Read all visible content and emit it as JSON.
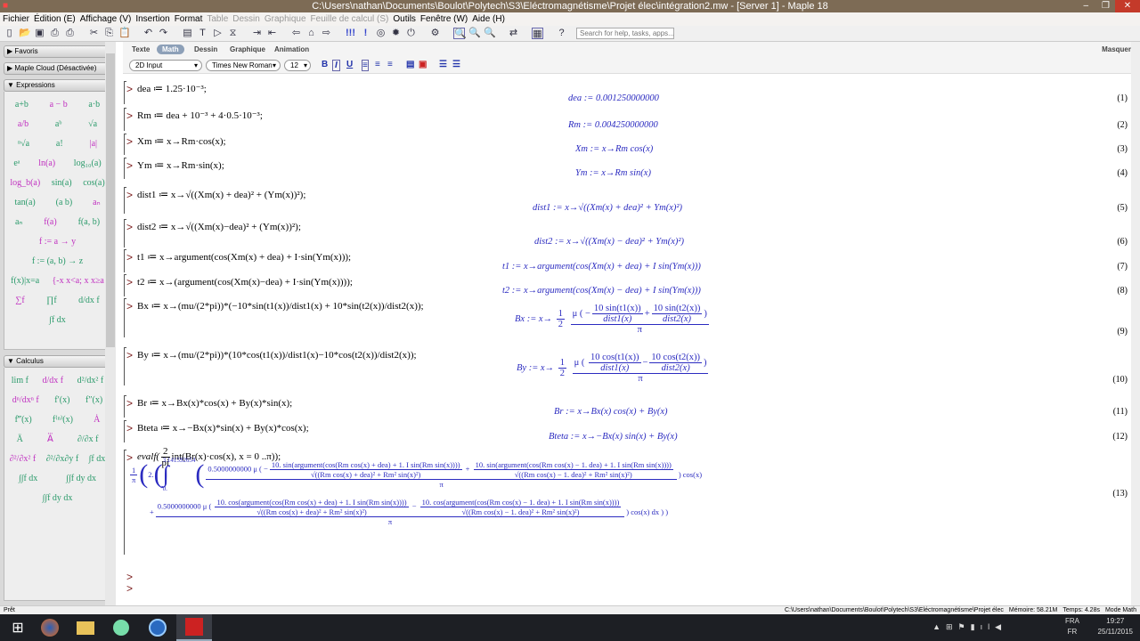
{
  "window": {
    "title": "C:\\Users\\nathan\\Documents\\Boulot\\Polytech\\S3\\Eléctromagnétisme\\Projet élec\\intégration2.mw - [Server 1] - Maple 18",
    "minimize": "–",
    "maximize": "❐",
    "close": "✕"
  },
  "menu": [
    {
      "label": "Fichier"
    },
    {
      "label": "Édition (E)"
    },
    {
      "label": "Affichage (V)"
    },
    {
      "label": "Insertion"
    },
    {
      "label": "Format"
    },
    {
      "label": "Table",
      "disabled": true
    },
    {
      "label": "Dessin",
      "disabled": true
    },
    {
      "label": "Graphique",
      "disabled": true
    },
    {
      "label": "Feuille de calcul (S)",
      "disabled": true
    },
    {
      "label": "Outils"
    },
    {
      "label": "Fenêtre (W)"
    },
    {
      "label": "Aide (H)"
    }
  ],
  "toolbar": {
    "search_placeholder": "Search for help, tasks, apps..."
  },
  "palettes": {
    "favoris": "Favoris",
    "cloud": "Maple Cloud (Désactivée)",
    "expressions": "Expressions",
    "calculus": "Calculus",
    "expr_rows": [
      [
        "a+b",
        "a − b",
        "a·b"
      ],
      [
        "a/b",
        "aᵇ",
        "√a"
      ],
      [
        "ⁿ√a",
        "a!",
        "|a|"
      ],
      [
        "eᵃ",
        "ln(a)",
        "log₁₀(a)"
      ],
      [
        "log_b(a)",
        "sin(a)",
        "cos(a)"
      ],
      [
        "tan(a)",
        "(a b)",
        "aₙ"
      ],
      [
        "aₙ",
        "f(a)",
        "f(a, b)"
      ],
      [
        "f := a → y"
      ],
      [
        "f := (a, b) → z"
      ],
      [
        "f(x)|x=a",
        "{-x x<a; x x≥a"
      ],
      [
        "∑f",
        "∏f",
        "d/dx f"
      ],
      [
        "∫f dx"
      ]
    ],
    "calc_rows": [
      [
        "lim f",
        "d/dx f",
        "d²/dx² f"
      ],
      [
        "dⁿ/dxⁿ f",
        "f′(x)",
        "f″(x)"
      ],
      [
        "f‴(x)",
        "f⁽ⁿ⁾(x)",
        "Ȧ"
      ],
      [
        "Ä",
        "A⃛",
        "∂/∂x f"
      ],
      [
        "∂²/∂x² f",
        "∂²/∂x∂y f",
        "∫f dx"
      ],
      [
        "∫∫f dx",
        "∫∫f dy dx"
      ],
      [
        "∫∫f dy dx"
      ]
    ]
  },
  "context": {
    "modes": [
      "Texte",
      "Math",
      "Dessin",
      "Graphique",
      "Animation"
    ],
    "input_mode": "2D Input",
    "font": "Times New Roman",
    "size": "12",
    "masquer": "Masquer"
  },
  "rows": [
    {
      "in": "dea ≔ 1.25·10⁻³;",
      "out": "dea := 0.001250000000",
      "label": "(1)"
    },
    {
      "in": "Rm ≔ dea + 10⁻³ + 4·0.5·10⁻³;",
      "out": "Rm := 0.004250000000",
      "label": "(2)"
    },
    {
      "in": "Xm ≔ x→Rm·cos(x);",
      "out": "Xm := x→Rm cos(x)",
      "label": "(3)"
    },
    {
      "in": "Ym ≔ x→Rm·sin(x);",
      "out": "Ym := x→Rm sin(x)",
      "label": "(4)"
    },
    {
      "in": "dist1 ≔ x→√((Xm(x) + dea)² + (Ym(x))²);",
      "out": "dist1 := x→√((Xm(x) + dea)² + Ym(x)²)",
      "label": "(5)"
    },
    {
      "in": "dist2 ≔ x→√((Xm(x)−dea)² + (Ym(x))²);",
      "out": "dist2 := x→√((Xm(x) − dea)² + Ym(x)²)",
      "label": "(6)"
    },
    {
      "in": "t1 ≔ x→argument(cos(Xm(x) + dea) + I·sin(Ym(x)));",
      "out": "t1 := x→argument(cos(Xm(x) + dea) + I sin(Ym(x)))",
      "label": "(7)"
    },
    {
      "in": "t2 ≔ x→(argument(cos(Xm(x)−dea) + I·sin(Ym(x))));",
      "out": "t2 := x→argument(cos(Xm(x) − dea) + I sin(Ym(x)))",
      "label": "(8)"
    },
    {
      "in": "Bx ≔ x→(mu/(2*pi))*(−10*sin(t1(x))/dist1(x) + 10*sin(t2(x))/dist2(x));",
      "label": "(9)"
    },
    {
      "in": "By ≔ x→(mu/(2*pi))*(10*cos(t1(x))/dist1(x)−10*cos(t2(x))/dist2(x));",
      "label": "(10)"
    },
    {
      "in": "Br ≔ x→Bx(x)*cos(x) + By(x)*sin(x);",
      "out": "Br := x→Bx(x) cos(x) + By(x)",
      "label": "(11)"
    },
    {
      "in": "Bteta ≔ x→−Bx(x)*sin(x) + By(x)*cos(x);",
      "out": "Bteta := x→−Bx(x) sin(x) + By(x)",
      "label": "(12)"
    },
    {
      "in_a": "evalf(",
      "in_num": "2",
      "in_den": "pi",
      "in_b": "int(Br(x)·cos(x), x = 0 ..π));",
      "label": "(13)"
    }
  ],
  "bx": {
    "lhs": "Bx := x→",
    "half_n": "1",
    "half_d": "2",
    "mu": "μ (",
    "t1n": "10 sin(t1(x))",
    "t1d": "dist1(x)",
    "t2n": "10 sin(t2(x))",
    "t2d": "dist2(x)",
    "pi": "π",
    "op1": "−",
    "op2": "+",
    "close": ")"
  },
  "by": {
    "lhs": "By := x→",
    "half_n": "1",
    "half_d": "2",
    "mu": "μ (",
    "t1n": "10 cos(t1(x))",
    "t1d": "dist1(x)",
    "t2n": "10 cos(t2(x))",
    "t2d": "dist2(x)",
    "pi": "π",
    "op2": "−",
    "close": ")"
  },
  "r13": {
    "inv_n": "1",
    "inv_d": "π",
    "two": "2.",
    "upper": "3.141592654",
    "lower": "0.",
    "coef": "0.5000000000 μ (",
    "sin1n": "10. sin(argument(cos(Rm cos(x) + dea) + 1. I sin(Rm sin(x))))",
    "sin1d": "√((Rm cos(x) + dea)² + Rm² sin(x)²)",
    "sin2n": "10. sin(argument(cos(Rm cos(x) − 1. dea) + 1. I sin(Rm sin(x))))",
    "sin2d": "√((Rm cos(x) − 1. dea)² + Rm² sin(x)²)",
    "cos1n": "10. cos(argument(cos(Rm cos(x) + dea) + 1. I sin(Rm sin(x))))",
    "cos1d": "√((Rm cos(x) + dea)² + Rm² sin(x)²)",
    "cos2n": "10. cos(argument(cos(Rm cos(x) − 1. dea) + 1. I sin(Rm sin(x))))",
    "cos2d": "√((Rm cos(x) − 1. dea)² + Rm² sin(x)²)",
    "pi": "π",
    "tail1": ") cos(x)",
    "tail2": ") cos(x) dx ) )",
    "plus": "+",
    "minus": "−",
    "neg": "−"
  },
  "status": {
    "left": "Prêt",
    "path": "C:\\Users\\nathan\\Documents\\Boulot\\Polytech\\S3\\Eléctromagnétisme\\Projet élec",
    "memory": "Mémoire: 58.21M",
    "time": "Temps: 4.28s",
    "mode": "Mode Math"
  },
  "taskbar": {
    "lang1": "FRA",
    "lang2": "FR",
    "clock": "19:27",
    "date": "25/11/2015"
  }
}
